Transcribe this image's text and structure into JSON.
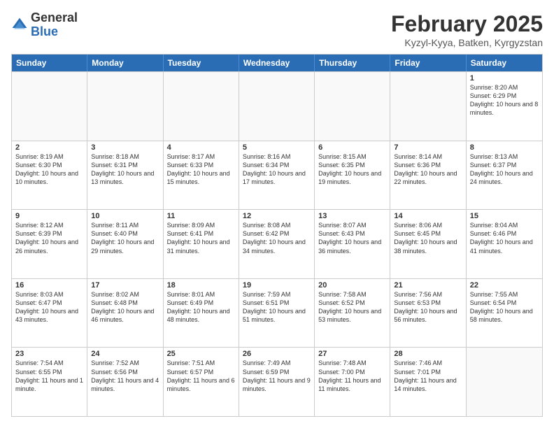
{
  "header": {
    "logo_general": "General",
    "logo_blue": "Blue",
    "month_title": "February 2025",
    "location": "Kyzyl-Kyya, Batken, Kyrgyzstan"
  },
  "weekdays": [
    "Sunday",
    "Monday",
    "Tuesday",
    "Wednesday",
    "Thursday",
    "Friday",
    "Saturday"
  ],
  "rows": [
    [
      {
        "day": "",
        "info": ""
      },
      {
        "day": "",
        "info": ""
      },
      {
        "day": "",
        "info": ""
      },
      {
        "day": "",
        "info": ""
      },
      {
        "day": "",
        "info": ""
      },
      {
        "day": "",
        "info": ""
      },
      {
        "day": "1",
        "info": "Sunrise: 8:20 AM\nSunset: 6:29 PM\nDaylight: 10 hours and 8 minutes."
      }
    ],
    [
      {
        "day": "2",
        "info": "Sunrise: 8:19 AM\nSunset: 6:30 PM\nDaylight: 10 hours and 10 minutes."
      },
      {
        "day": "3",
        "info": "Sunrise: 8:18 AM\nSunset: 6:31 PM\nDaylight: 10 hours and 13 minutes."
      },
      {
        "day": "4",
        "info": "Sunrise: 8:17 AM\nSunset: 6:33 PM\nDaylight: 10 hours and 15 minutes."
      },
      {
        "day": "5",
        "info": "Sunrise: 8:16 AM\nSunset: 6:34 PM\nDaylight: 10 hours and 17 minutes."
      },
      {
        "day": "6",
        "info": "Sunrise: 8:15 AM\nSunset: 6:35 PM\nDaylight: 10 hours and 19 minutes."
      },
      {
        "day": "7",
        "info": "Sunrise: 8:14 AM\nSunset: 6:36 PM\nDaylight: 10 hours and 22 minutes."
      },
      {
        "day": "8",
        "info": "Sunrise: 8:13 AM\nSunset: 6:37 PM\nDaylight: 10 hours and 24 minutes."
      }
    ],
    [
      {
        "day": "9",
        "info": "Sunrise: 8:12 AM\nSunset: 6:39 PM\nDaylight: 10 hours and 26 minutes."
      },
      {
        "day": "10",
        "info": "Sunrise: 8:11 AM\nSunset: 6:40 PM\nDaylight: 10 hours and 29 minutes."
      },
      {
        "day": "11",
        "info": "Sunrise: 8:09 AM\nSunset: 6:41 PM\nDaylight: 10 hours and 31 minutes."
      },
      {
        "day": "12",
        "info": "Sunrise: 8:08 AM\nSunset: 6:42 PM\nDaylight: 10 hours and 34 minutes."
      },
      {
        "day": "13",
        "info": "Sunrise: 8:07 AM\nSunset: 6:43 PM\nDaylight: 10 hours and 36 minutes."
      },
      {
        "day": "14",
        "info": "Sunrise: 8:06 AM\nSunset: 6:45 PM\nDaylight: 10 hours and 38 minutes."
      },
      {
        "day": "15",
        "info": "Sunrise: 8:04 AM\nSunset: 6:46 PM\nDaylight: 10 hours and 41 minutes."
      }
    ],
    [
      {
        "day": "16",
        "info": "Sunrise: 8:03 AM\nSunset: 6:47 PM\nDaylight: 10 hours and 43 minutes."
      },
      {
        "day": "17",
        "info": "Sunrise: 8:02 AM\nSunset: 6:48 PM\nDaylight: 10 hours and 46 minutes."
      },
      {
        "day": "18",
        "info": "Sunrise: 8:01 AM\nSunset: 6:49 PM\nDaylight: 10 hours and 48 minutes."
      },
      {
        "day": "19",
        "info": "Sunrise: 7:59 AM\nSunset: 6:51 PM\nDaylight: 10 hours and 51 minutes."
      },
      {
        "day": "20",
        "info": "Sunrise: 7:58 AM\nSunset: 6:52 PM\nDaylight: 10 hours and 53 minutes."
      },
      {
        "day": "21",
        "info": "Sunrise: 7:56 AM\nSunset: 6:53 PM\nDaylight: 10 hours and 56 minutes."
      },
      {
        "day": "22",
        "info": "Sunrise: 7:55 AM\nSunset: 6:54 PM\nDaylight: 10 hours and 58 minutes."
      }
    ],
    [
      {
        "day": "23",
        "info": "Sunrise: 7:54 AM\nSunset: 6:55 PM\nDaylight: 11 hours and 1 minute."
      },
      {
        "day": "24",
        "info": "Sunrise: 7:52 AM\nSunset: 6:56 PM\nDaylight: 11 hours and 4 minutes."
      },
      {
        "day": "25",
        "info": "Sunrise: 7:51 AM\nSunset: 6:57 PM\nDaylight: 11 hours and 6 minutes."
      },
      {
        "day": "26",
        "info": "Sunrise: 7:49 AM\nSunset: 6:59 PM\nDaylight: 11 hours and 9 minutes."
      },
      {
        "day": "27",
        "info": "Sunrise: 7:48 AM\nSunset: 7:00 PM\nDaylight: 11 hours and 11 minutes."
      },
      {
        "day": "28",
        "info": "Sunrise: 7:46 AM\nSunset: 7:01 PM\nDaylight: 11 hours and 14 minutes."
      },
      {
        "day": "",
        "info": ""
      }
    ]
  ]
}
